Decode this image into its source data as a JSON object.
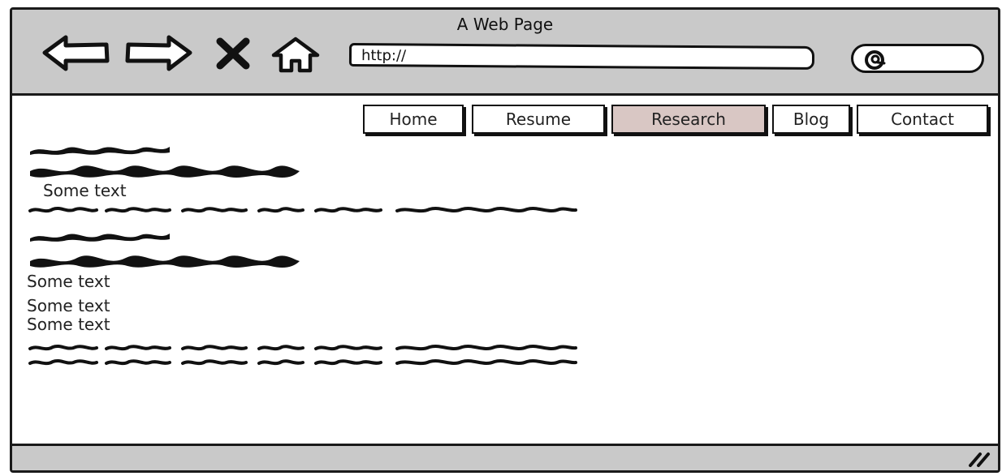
{
  "window": {
    "title": "A Web Page"
  },
  "toolbar": {
    "back_icon": "arrow-left-icon",
    "forward_icon": "arrow-right-icon",
    "stop_icon": "close-icon",
    "home_icon": "home-icon",
    "url_value": "http://",
    "search_icon": "search-icon"
  },
  "nav": {
    "tabs": [
      {
        "label": "Home",
        "active": false
      },
      {
        "label": "Resume",
        "active": false
      },
      {
        "label": "Research",
        "active": true
      },
      {
        "label": "Blog",
        "active": false
      },
      {
        "label": "Contact",
        "active": false
      }
    ]
  },
  "content": {
    "text_1": "Some text",
    "text_2": "Some text",
    "text_3": "Some text",
    "text_4": "Some text"
  },
  "colors": {
    "chrome": "#c9c9c9",
    "active_tab": "#d9c7c4",
    "ink": "#111111"
  }
}
